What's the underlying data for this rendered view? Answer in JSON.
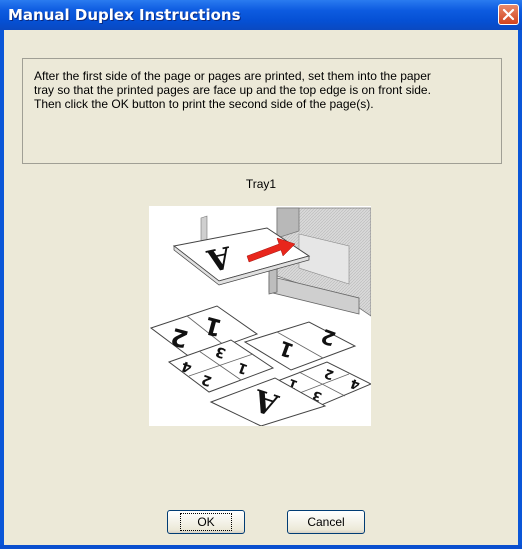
{
  "window": {
    "title": "Manual Duplex Instructions"
  },
  "instructions": {
    "line1": "After the first side of the page or pages are printed, set them into the paper",
    "line2": "tray so that the printed pages are face up and the top edge is on front side.",
    "line3": "Then click the OK button to print the second side of the page(s)."
  },
  "tray": {
    "label": "Tray1"
  },
  "buttons": {
    "ok_label": "OK",
    "cancel_label": "Cancel"
  },
  "icons": {
    "close": "close-icon",
    "illustration": "paper-tray-illustration"
  },
  "colors": {
    "titlebar": "#0550d4",
    "dialog_background": "#ece9d8",
    "close_button": "#d2421d",
    "arrow": "#e8261c"
  }
}
